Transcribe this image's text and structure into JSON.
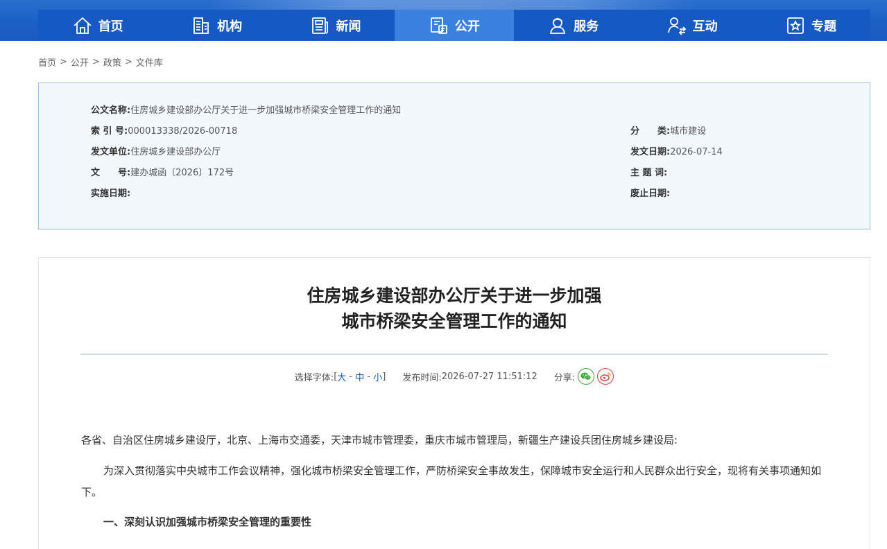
{
  "nav": {
    "items": [
      {
        "label": "首页",
        "icon": "home-icon"
      },
      {
        "label": "机构",
        "icon": "building-icon"
      },
      {
        "label": "新闻",
        "icon": "news-icon"
      },
      {
        "label": "公开",
        "icon": "disclosure-icon",
        "active": true
      },
      {
        "label": "服务",
        "icon": "service-icon"
      },
      {
        "label": "互动",
        "icon": "interaction-icon"
      },
      {
        "label": "专题",
        "icon": "star-icon"
      }
    ]
  },
  "breadcrumb": [
    "首页",
    "公开",
    "政策",
    "文件库"
  ],
  "breadcrumb_sep": ">",
  "info": {
    "name_label": "公文名称:",
    "name_value": "住房城乡建设部办公厅关于进一步加强城市桥梁安全管理工作的通知",
    "index_label": "索 引 号:",
    "index_value": "000013338/2026-00718",
    "category_label": "分　　类:",
    "category_value": "城市建设",
    "issuer_label": "发文单位:",
    "issuer_value": "住房城乡建设部办公厅",
    "date_label": "发文日期:",
    "date_value": "2026-07-14",
    "docno_label": "文　　号:",
    "docno_value": "建办城函〔2026〕172号",
    "subject_label": "主 题 词:",
    "subject_value": "",
    "effective_label": "实施日期:",
    "effective_value": "",
    "repeal_label": "废止日期:",
    "repeal_value": ""
  },
  "article": {
    "title_line1": "住房城乡建设部办公厅关于进一步加强",
    "title_line2": "城市桥梁安全管理工作的通知",
    "font_select_label": "选择字体:",
    "font_large": "大",
    "font_medium": "中",
    "font_small": "小",
    "publish_label": "发布时间:",
    "publish_time": "2026-07-27 11:51:12",
    "share_label": "分享:",
    "greeting": "各省、自治区住房城乡建设厅，北京、上海市交通委，天津市城市管理委，重庆市城市管理局，新疆生产建设兵团住房城乡建设局:",
    "intro": "为深入贯彻落实中央城市工作会议精神，强化城市桥梁安全管理工作，严防桥梁安全事故发生，保障城市安全运行和人民群众出行安全，现将有关事项通知如下。",
    "heading1": "一、深刻认识加强城市桥梁安全管理的重要性"
  },
  "colors": {
    "nav_bg": "#1659c3",
    "nav_active": "#3b82e0",
    "info_bg": "#f3f8fd",
    "info_border": "#9bc3e6",
    "link": "#1658b6",
    "wechat": "#3aa832",
    "weibo": "#d43a3a"
  }
}
